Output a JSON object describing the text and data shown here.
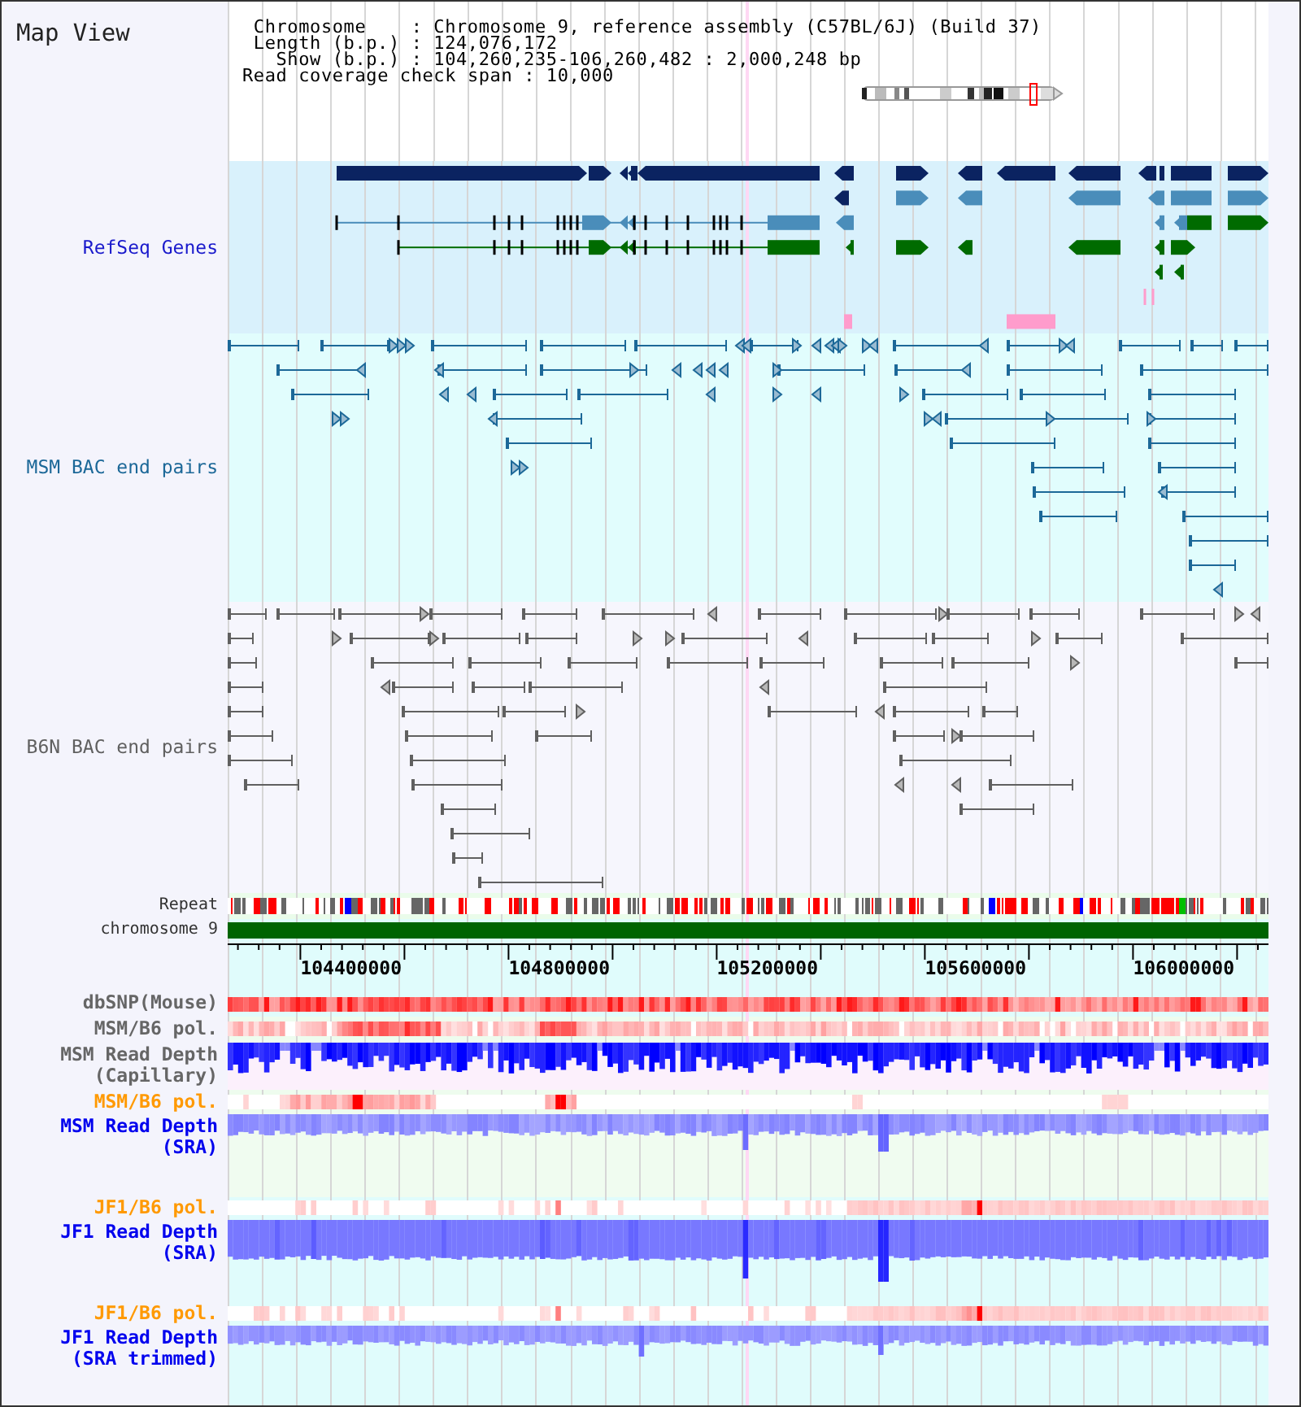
{
  "title": "Map View",
  "info_lines": [
    "Chromosome    : Chromosome 9, reference assembly (C57BL/6J) (Build 37)",
    "Length (b.p.) : 124,076,172",
    "Show (b.p.) : 104,260,235-106,260,482 : 2,000,248 bp",
    "Read coverage check span : 10,000"
  ],
  "tracks": [
    {
      "kind": "genes",
      "label": "RefSeq Genes",
      "color": "#1a1acc"
    },
    {
      "kind": "bac_pairs",
      "label": "MSM BAC end pairs",
      "color": "#1c6898"
    },
    {
      "kind": "bac_pairs",
      "label": "B6N BAC end pairs",
      "color": "#606060"
    },
    {
      "kind": "repeat",
      "label": "Repeat",
      "color": "#333333"
    },
    {
      "kind": "chromosome",
      "label": "chromosome 9",
      "color": "#333333"
    },
    {
      "kind": "axis",
      "tick_labels": [
        "104400000",
        "104800000",
        "105200000",
        "105600000",
        "106000000"
      ]
    },
    {
      "kind": "heatmap",
      "label": "dbSNP(Mouse)",
      "color": "#666666"
    },
    {
      "kind": "heatmap",
      "label": "MSM/B6 pol.",
      "color": "#666666"
    },
    {
      "kind": "depth",
      "label": "MSM Read Depth (Capillary)",
      "color": "#666666"
    },
    {
      "kind": "heatmap",
      "label": "MSM/B6 pol.",
      "color": "#ff9900"
    },
    {
      "kind": "depth",
      "label": "MSM Read Depth (SRA)",
      "color": "#0000ee"
    },
    {
      "kind": "heatmap",
      "label": "JF1/B6 pol.",
      "color": "#ff9900"
    },
    {
      "kind": "depth",
      "label": "JF1 Read Depth (SRA)",
      "color": "#0000ee"
    },
    {
      "kind": "heatmap",
      "label": "JF1/B6 pol.",
      "color": "#ff9900"
    },
    {
      "kind": "depth",
      "label": "JF1 Read Depth (SRA trimmed)",
      "color": "#0000ee"
    }
  ]
}
